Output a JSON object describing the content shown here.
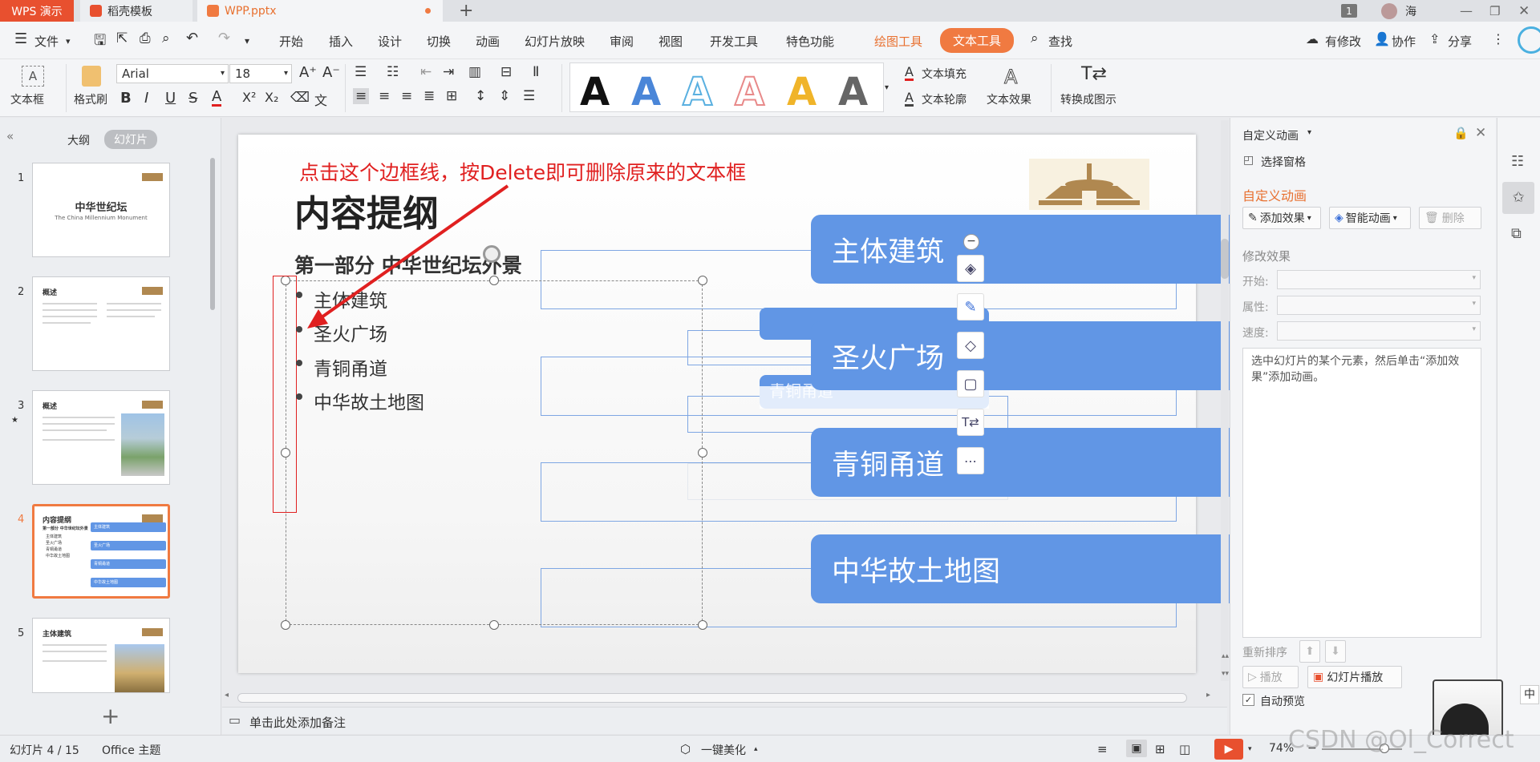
{
  "titlebar": {
    "app_tab": "WPS 演示",
    "tab2": "稻壳模板",
    "tab3": "WPP.pptx",
    "badge": "1",
    "user": "海"
  },
  "menubar": {
    "file": "文件",
    "items": [
      "开始",
      "插入",
      "设计",
      "切换",
      "动画",
      "幻灯片放映",
      "审阅",
      "视图",
      "开发工具",
      "特色功能"
    ],
    "drawing_tools": "绘图工具",
    "text_tools": "文本工具",
    "search": "查找",
    "modify": "有修改",
    "collab": "协作",
    "share": "分享"
  },
  "ribbon": {
    "textbox": "文本框",
    "format_painter": "格式刷",
    "font_name": "Arial",
    "font_size": "18",
    "text_fill": "文本填充",
    "text_outline": "文本轮廓",
    "text_effect": "文本效果",
    "convert": "转换成图示",
    "style_colors": [
      "#111111",
      "#4a86d8",
      "#5ab0e0",
      "#e88a8a",
      "#f0b429",
      "#666666"
    ]
  },
  "leftpanel": {
    "outline_tab": "大纲",
    "slides_tab": "幻灯片",
    "thumbs": [
      {
        "num": "1",
        "title": "中华世纪坛",
        "subtitle": "The China Millennium Monument"
      },
      {
        "num": "2",
        "title": "概述"
      },
      {
        "num": "3",
        "title": "概述"
      },
      {
        "num": "4",
        "title": "内容提纲",
        "sub": "第一部分 中华世纪坛外景",
        "items": [
          "主体建筑",
          "圣火广场",
          "青铜甬道",
          "中华故土地图"
        ]
      },
      {
        "num": "5",
        "title": "主体建筑"
      }
    ]
  },
  "slide": {
    "annotation": "点击这个边框线，按Delete即可删除原来的文本框",
    "title": "内容提纲",
    "subtitle": "第一部分 中华世纪坛外景",
    "bullets": [
      "主体建筑",
      "圣火广场",
      "青铜甬道",
      "中华故土地图"
    ],
    "pills": [
      "主体建筑",
      "圣火广场",
      "青铜甬道",
      "中华故土地图"
    ],
    "hidden_text": "青铜甬道",
    "accent_color": "#6196e5",
    "annotation_color": "#e02020"
  },
  "notes": "单击此处添加备注",
  "rightpanel": {
    "title": "自定义动画",
    "select_pane": "选择窗格",
    "section": "自定义动画",
    "add_effect": "添加效果",
    "smart_anim": "智能动画",
    "delete": "删除",
    "modify_effect": "修改效果",
    "start_label": "开始:",
    "prop_label": "属性:",
    "speed_label": "速度:",
    "hint": "选中幻灯片的某个元素，然后单击“添加效果”添加动画。",
    "reorder": "重新排序",
    "play": "播放",
    "slideshow": "幻灯片播放",
    "autopreview": "自动预览",
    "ime": "中"
  },
  "statusbar": {
    "slide_counter": "幻灯片 4 / 15",
    "theme": "Office 主题",
    "beautify": "一键美化",
    "zoom": "74%",
    "watermark": "CSDN @Ol_Correct"
  }
}
